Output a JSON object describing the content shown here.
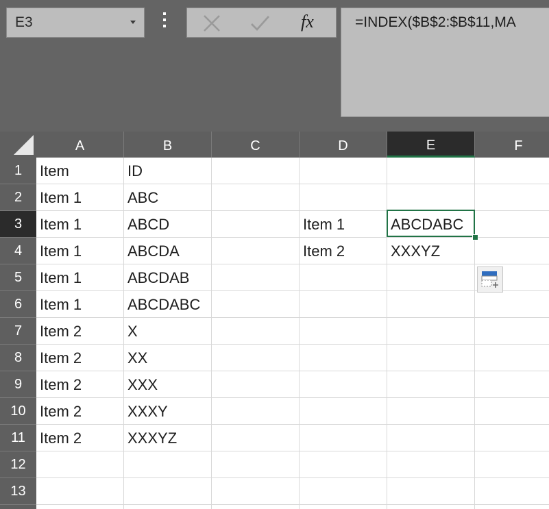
{
  "name_box": {
    "value": "E3"
  },
  "formula_bar": {
    "fx_label": "fx",
    "formula": "=INDEX($B$2:$B$11,MA"
  },
  "columns": [
    "A",
    "B",
    "C",
    "D",
    "E",
    "F"
  ],
  "rows": [
    "1",
    "2",
    "3",
    "4",
    "5",
    "6",
    "7",
    "8",
    "9",
    "10",
    "11",
    "12",
    "13"
  ],
  "selected_column": "E",
  "selected_row": "3",
  "cells": {
    "A1": "Item",
    "B1": "ID",
    "A2": "Item 1",
    "B2": "ABC",
    "A3": "Item 1",
    "B3": "ABCD",
    "D3": "Item 1",
    "E3": "ABCDABC",
    "A4": "Item 1",
    "B4": "ABCDA",
    "D4": "Item 2",
    "E4": "XXXYZ",
    "A5": "Item 1",
    "B5": "ABCDAB",
    "A6": "Item 1",
    "B6": "ABCDABC",
    "A7": "Item 2",
    "B7": "X",
    "A8": "Item 2",
    "B8": "XX",
    "A9": "Item 2",
    "B9": "XXX",
    "A10": "Item 2",
    "B10": "XXXY",
    "A11": "Item 2",
    "B11": "XXXYZ"
  },
  "colors": {
    "accent": "#217346",
    "header_bg": "#5f5f5f",
    "selected_header_bg": "#2b2b2b",
    "toolbar_bg": "#646464"
  },
  "icons": {
    "cancel": "close-icon",
    "enter": "checkmark-icon",
    "insert_function": "fx-icon",
    "name_box_dropdown": "chevron-down-icon",
    "paste_options": "paste-options-icon"
  }
}
